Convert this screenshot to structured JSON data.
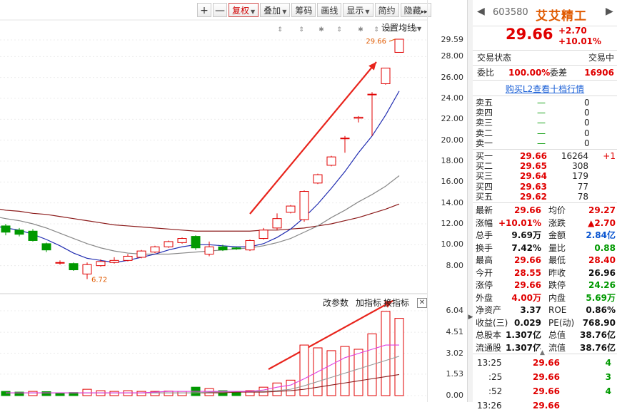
{
  "toolbar": {
    "plus": "+",
    "minus": "—",
    "buttons": [
      "复权",
      "叠加",
      "筹码",
      "画线",
      "显示",
      "简约",
      "隐藏"
    ],
    "more": "▸▸"
  },
  "main_chart": {
    "ma_settings_label": "设置均线",
    "price_axis": [
      "29.59",
      "28.00",
      "26.00",
      "24.00",
      "22.00",
      "20.00",
      "18.00",
      "16.00",
      "14.00",
      "12.00",
      "10.00",
      "8.00"
    ],
    "high_label": "29.66",
    "low_label": "6.72",
    "event_markers": [
      "⇕",
      "⇕",
      "✱",
      "⇕",
      "✱",
      "⇕",
      "⇕",
      "⇕",
      "⇕"
    ]
  },
  "indicator": {
    "menu": [
      "改参数",
      "加指标",
      "换指标"
    ],
    "close": "✕",
    "axis": [
      "6.04",
      "4.51",
      "3.02",
      "1.53",
      "0.00"
    ]
  },
  "stock": {
    "code": "603580",
    "name": "艾艾精工",
    "price": "29.66",
    "change": "+2.70",
    "change_pct": "+10.01%",
    "status_label": "交易状态",
    "status_value": "交易中",
    "weibi_label": "委比",
    "weibi_value": "100.00%",
    "weicha_label": "委差",
    "weicha_value": "16906",
    "l2_link": "购买L2查看十档行情"
  },
  "asks": [
    {
      "label": "卖五",
      "price": "—",
      "vol": "0"
    },
    {
      "label": "卖四",
      "price": "—",
      "vol": "0"
    },
    {
      "label": "卖三",
      "price": "—",
      "vol": "0"
    },
    {
      "label": "卖二",
      "price": "—",
      "vol": "0"
    },
    {
      "label": "卖一",
      "price": "—",
      "vol": "0"
    }
  ],
  "bids": [
    {
      "label": "买一",
      "price": "29.66",
      "vol": "16264",
      "delta": "+1"
    },
    {
      "label": "买二",
      "price": "29.65",
      "vol": "308",
      "delta": ""
    },
    {
      "label": "买三",
      "price": "29.64",
      "vol": "179",
      "delta": ""
    },
    {
      "label": "买四",
      "price": "29.63",
      "vol": "77",
      "delta": ""
    },
    {
      "label": "买五",
      "price": "29.62",
      "vol": "78",
      "delta": ""
    }
  ],
  "stats": [
    {
      "l1": "最新",
      "v1": "29.66",
      "c1": "red",
      "l2": "均价",
      "v2": "29.27",
      "c2": "red"
    },
    {
      "l1": "涨幅",
      "v1": "+10.01%",
      "c1": "red",
      "l2": "涨跌",
      "v2": "▲2.70",
      "c2": "red"
    },
    {
      "l1": "总手",
      "v1": "9.69万",
      "c1": "bk",
      "l2": "金额",
      "v2": "2.84亿",
      "c2": "blue"
    },
    {
      "l1": "换手",
      "v1": "7.42%",
      "c1": "bk",
      "l2": "量比",
      "v2": "0.88",
      "c2": "green"
    },
    {
      "l1": "最高",
      "v1": "29.66",
      "c1": "red",
      "l2": "最低",
      "v2": "28.40",
      "c2": "red"
    },
    {
      "l1": "今开",
      "v1": "28.55",
      "c1": "red",
      "l2": "昨收",
      "v2": "26.96",
      "c2": "bk"
    },
    {
      "l1": "涨停",
      "v1": "29.66",
      "c1": "red",
      "l2": "跌停",
      "v2": "24.26",
      "c2": "green"
    },
    {
      "l1": "外盘",
      "v1": "4.00万",
      "c1": "red",
      "l2": "内盘",
      "v2": "5.69万",
      "c2": "green"
    },
    {
      "l1": "净资产",
      "v1": "3.37",
      "c1": "bk",
      "l2": "ROE",
      "v2": "0.86%",
      "c2": "bk"
    },
    {
      "l1": "收益(三)",
      "v1": "0.029",
      "c1": "bk",
      "l2": "PE(动)",
      "v2": "768.90",
      "c2": "bk"
    },
    {
      "l1": "总股本",
      "v1": "1.307亿",
      "c1": "bk",
      "l2": "总值",
      "v2": "38.76亿",
      "c2": "bk"
    },
    {
      "l1": "流通股",
      "v1": "1.307亿",
      "c1": "bk",
      "l2": "流值",
      "v2": "38.76亿",
      "c2": "bk"
    }
  ],
  "ticks": [
    {
      "time": "13:25",
      "price": "29.66",
      "vol": "4"
    },
    {
      "time": ":25",
      "price": "29.66",
      "vol": "3"
    },
    {
      "time": ":52",
      "price": "29.66",
      "vol": "4"
    },
    {
      "time": "13:26",
      "price": "29.66",
      "vol": ""
    }
  ],
  "colors": {
    "up": "#e00000",
    "down": "#009900",
    "ma5": "#1f2bb0",
    "ma10": "#888888",
    "ma20": "#8b1a1a",
    "vol_ma1": "#e040e0",
    "arrow": "#e8241c",
    "name": "#e05a00"
  },
  "chart_data": {
    "type": "candlestick",
    "ylim": [
      6,
      30
    ],
    "candles": [
      {
        "o": 11.8,
        "c": 11.2,
        "h": 12.0,
        "l": 10.9
      },
      {
        "o": 11.4,
        "c": 11.0,
        "h": 11.6,
        "l": 10.8
      },
      {
        "o": 11.3,
        "c": 10.4,
        "h": 11.5,
        "l": 10.3
      },
      {
        "o": 10.1,
        "c": 9.5,
        "h": 10.2,
        "l": 9.3
      },
      {
        "o": 8.3,
        "c": 8.3,
        "h": 8.5,
        "l": 8.1
      },
      {
        "o": 8.2,
        "c": 7.6,
        "h": 8.3,
        "l": 7.5
      },
      {
        "o": 7.2,
        "c": 8.1,
        "h": 8.3,
        "l": 6.72
      },
      {
        "o": 8.0,
        "c": 8.4,
        "h": 8.6,
        "l": 7.9
      },
      {
        "o": 8.3,
        "c": 8.5,
        "h": 8.8,
        "l": 8.2
      },
      {
        "o": 8.5,
        "c": 8.9,
        "h": 9.1,
        "l": 8.4
      },
      {
        "o": 8.8,
        "c": 9.4,
        "h": 9.5,
        "l": 8.7
      },
      {
        "o": 9.3,
        "c": 9.8,
        "h": 9.9,
        "l": 9.2
      },
      {
        "o": 9.8,
        "c": 10.3,
        "h": 10.4,
        "l": 9.7
      },
      {
        "o": 10.2,
        "c": 10.6,
        "h": 10.7,
        "l": 10.1
      },
      {
        "o": 10.8,
        "c": 9.7,
        "h": 10.9,
        "l": 9.5
      },
      {
        "o": 9.1,
        "c": 9.8,
        "h": 10.3,
        "l": 8.9
      },
      {
        "o": 9.8,
        "c": 9.5,
        "h": 10.0,
        "l": 9.4
      },
      {
        "o": 9.7,
        "c": 9.6,
        "h": 9.8,
        "l": 9.5
      },
      {
        "o": 9.5,
        "c": 10.4,
        "h": 10.5,
        "l": 9.4
      },
      {
        "o": 10.6,
        "c": 11.4,
        "h": 11.6,
        "l": 10.5
      },
      {
        "o": 11.6,
        "c": 12.5,
        "h": 13.0,
        "l": 11.4
      },
      {
        "o": 13.1,
        "c": 13.7,
        "h": 13.8,
        "l": 13.0
      },
      {
        "o": 12.4,
        "c": 15.1,
        "h": 15.2,
        "l": 12.2
      },
      {
        "o": 15.9,
        "c": 16.7,
        "h": 16.8,
        "l": 15.8
      },
      {
        "o": 17.6,
        "c": 18.4,
        "h": 18.5,
        "l": 17.5
      },
      {
        "o": 20.2,
        "c": 20.2,
        "h": 20.4,
        "l": 18.8
      },
      {
        "o": 22.1,
        "c": 22.2,
        "h": 22.3,
        "l": 21.7
      },
      {
        "o": 24.4,
        "c": 24.4,
        "h": 24.6,
        "l": 20.4
      },
      {
        "o": 25.4,
        "c": 26.9,
        "h": 26.9,
        "l": 25.3
      },
      {
        "o": 28.4,
        "c": 29.66,
        "h": 29.66,
        "l": 28.4
      }
    ],
    "ma5": [
      11.6,
      11.4,
      11.0,
      10.5,
      9.9,
      9.2,
      8.7,
      8.5,
      8.3,
      8.5,
      8.8,
      9.1,
      9.5,
      9.8,
      10.0,
      10.0,
      9.9,
      9.8,
      9.8,
      10.1,
      10.7,
      11.5,
      12.6,
      13.9,
      15.4,
      17.0,
      18.8,
      20.4,
      22.4,
      24.7
    ],
    "ma10": [
      12.5,
      12.3,
      12.0,
      11.6,
      11.1,
      10.6,
      10.1,
      9.7,
      9.4,
      9.2,
      9.1,
      9.1,
      9.1,
      9.2,
      9.3,
      9.4,
      9.5,
      9.6,
      9.7,
      9.9,
      10.2,
      10.6,
      11.2,
      11.8,
      12.6,
      13.3,
      14.1,
      14.8,
      15.6,
      16.6
    ],
    "ma20": [
      13.3,
      13.2,
      13.0,
      12.9,
      12.7,
      12.5,
      12.3,
      12.1,
      11.9,
      11.8,
      11.7,
      11.6,
      11.5,
      11.4,
      11.3,
      11.3,
      11.3,
      11.3,
      11.3,
      11.4,
      11.4,
      11.5,
      11.6,
      11.8,
      12.0,
      12.3,
      12.6,
      13.0,
      13.4,
      13.9
    ],
    "volume": {
      "ylim": [
        0,
        6.04
      ],
      "bars": [
        0.3,
        0.25,
        0.3,
        0.28,
        0.2,
        0.22,
        0.45,
        0.35,
        0.3,
        0.35,
        0.3,
        0.3,
        0.32,
        0.3,
        0.6,
        0.5,
        0.35,
        0.3,
        0.35,
        0.6,
        0.9,
        1.1,
        3.6,
        3.4,
        3.2,
        3.5,
        3.3,
        4.4,
        6.0,
        5.5
      ],
      "up": [
        false,
        false,
        true,
        false,
        false,
        false,
        true,
        true,
        true,
        true,
        true,
        true,
        true,
        true,
        false,
        true,
        false,
        false,
        true,
        true,
        true,
        true,
        true,
        true,
        true,
        true,
        true,
        true,
        true,
        true
      ],
      "ma1": [
        0.2,
        0.2,
        0.2,
        0.2,
        0.2,
        0.2,
        0.2,
        0.2,
        0.2,
        0.2,
        0.2,
        0.25,
        0.3,
        0.3,
        0.3,
        0.3,
        0.3,
        0.3,
        0.3,
        0.4,
        0.6,
        0.75,
        1.2,
        1.7,
        2.2,
        2.7,
        3.0,
        3.3,
        3.6,
        3.6
      ],
      "ma2": [
        0.2,
        0.2,
        0.2,
        0.2,
        0.2,
        0.2,
        0.2,
        0.2,
        0.2,
        0.2,
        0.2,
        0.2,
        0.2,
        0.2,
        0.2,
        0.25,
        0.25,
        0.3,
        0.3,
        0.3,
        0.35,
        0.45,
        0.7,
        1.0,
        1.3,
        1.6,
        1.9,
        2.2,
        2.5,
        2.8
      ],
      "ma3": [
        0.2,
        0.2,
        0.2,
        0.2,
        0.2,
        0.2,
        0.2,
        0.2,
        0.2,
        0.2,
        0.2,
        0.2,
        0.2,
        0.2,
        0.2,
        0.2,
        0.2,
        0.25,
        0.25,
        0.25,
        0.3,
        0.35,
        0.45,
        0.6,
        0.75,
        0.9,
        1.05,
        1.2,
        1.35,
        1.5
      ]
    }
  }
}
